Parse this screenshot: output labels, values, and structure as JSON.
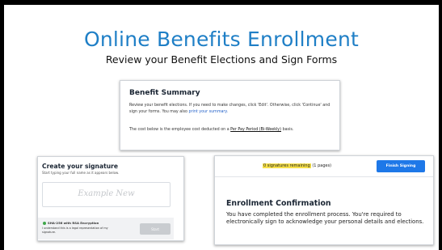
{
  "slide": {
    "title": "Online Benefits Enrollment",
    "subtitle": "Review your Benefit Elections and Sign Forms"
  },
  "benefit_summary": {
    "heading": "Benefit Summary",
    "instructions": "Review your benefit elections. If you need to make changes, click 'Edit'. Otherwise, click 'Continue' and sign your forms. You may also",
    "print_link": "print your summary.",
    "cost_note_prefix": "The cost below is the employee cost deducted on a",
    "pay_period": "Per Pay Period (Bi-Weekly)",
    "cost_note_suffix": "basis."
  },
  "signature": {
    "heading": "Create your signature",
    "hint": "Start typing your full name as it appears below.",
    "placeholder": "Example New",
    "encryption": "SHA-256 with RSA Encryption",
    "legal_text": "I understand this is a legal representation of my signature.",
    "start_label": "Start"
  },
  "confirmation": {
    "remaining_count": "0 signatures remaining",
    "pages_note": "(1 pages)",
    "finish_label": "Finish Signing",
    "heading": "Enrollment Confirmation",
    "body": "You have completed the enrollment process. You're required to electronically sign to acknowledge your personal details and elections."
  },
  "colors": {
    "title": "#1f7fc6",
    "finish_button": "#1e78e8",
    "highlight": "#f6e04a",
    "secure_dot": "#3fa64a"
  }
}
